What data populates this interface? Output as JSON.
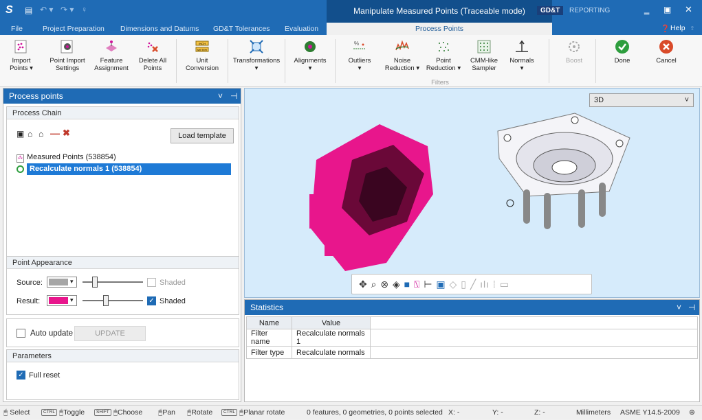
{
  "title": {
    "context": "Manipulate Measured Points (Traceable mode)",
    "tag_gdt": "GD&T",
    "tag_reporting": "REPORTING"
  },
  "help": "Help",
  "tabs": [
    "File",
    "Project Preparation",
    "Dimensions and Datums",
    "GD&T Tolerances",
    "Evaluation",
    "Process Points"
  ],
  "ribbon": {
    "import_points": "Import\nPoints ▾",
    "import_settings": "Point Import\nSettings",
    "feature_assignment": "Feature\nAssignment",
    "delete_all": "Delete All\nPoints",
    "unit_conversion": "Unit\nConversion",
    "transformations": "Transformations\n▾",
    "alignments": "Alignments\n▾",
    "outliers": "Outliers\n▾",
    "noise_reduction": "Noise\nReduction ▾",
    "point_reduction": "Point\nReduction ▾",
    "cmm_sampler": "CMM-like\nSampler",
    "normals": "Normals\n▾",
    "boost": "Boost",
    "done": "Done",
    "cancel": "Cancel",
    "filters_group": "Filters"
  },
  "left_panel": {
    "title": "Process points",
    "process_chain": "Process Chain",
    "load_template": "Load template",
    "chain_items": [
      "Measured Points (538854)",
      "Recalculate normals 1 (538854)"
    ],
    "point_appearance": "Point Appearance",
    "source_label": "Source:",
    "result_label": "Result:",
    "shaded": "Shaded",
    "auto_update": "Auto update",
    "update": "UPDATE",
    "parameters": "Parameters",
    "full_reset": "Full reset"
  },
  "view": {
    "mode": "3D"
  },
  "statistics": {
    "title": "Statistics",
    "headers": [
      "Name",
      "Value"
    ],
    "rows": [
      [
        "Filter name",
        "Recalculate normals 1"
      ],
      [
        "Filter type",
        "Recalculate normals"
      ]
    ]
  },
  "status": {
    "select": "Select",
    "ctrl": "CTRL",
    "toggle": "Toggle",
    "shift": "SHIFT",
    "choose": "Choose",
    "pan": "Pan",
    "rotate": "Rotate",
    "planar": "Planar rotate",
    "info": "0 features, 0 geometries, 0 points selected",
    "x": "X: -",
    "y": "Y: -",
    "z": "Z: -",
    "units": "Millimeters",
    "standard": "ASME Y14.5-2009"
  },
  "colors": {
    "accent": "#1f6bb5",
    "source_swatch": "#a6a6a6",
    "result_swatch": "#e8168c"
  }
}
